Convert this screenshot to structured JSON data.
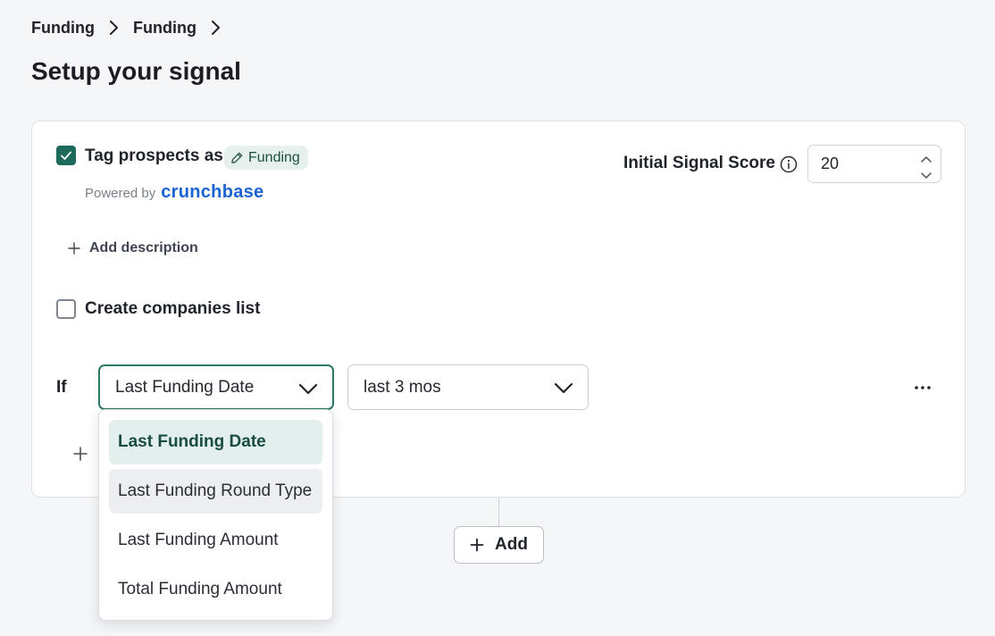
{
  "breadcrumb": [
    "Funding",
    "Funding"
  ],
  "page_title": "Setup your signal",
  "card": {
    "tag_checked": true,
    "tag_label": "Tag prospects as",
    "tag_chip": "Funding",
    "powered_by": "Powered by",
    "provider": "crunchbase",
    "add_description": "Add description",
    "create_list_checked": false,
    "create_list_label": "Create companies list",
    "score_label": "Initial Signal Score",
    "score_value": "20",
    "if_label": "If",
    "field_select": "Last Funding Date",
    "range_select": "last 3 mos"
  },
  "dropdown": {
    "options": [
      "Last Funding Date",
      "Last Funding Round Type",
      "Last Funding Amount",
      "Total Funding Amount"
    ],
    "selected": "Last Funding Date",
    "hovered": "Last Funding Round Type"
  },
  "add_button": "Add",
  "colors": {
    "accent": "#1d6a5b",
    "chip_bg": "#e6f1ee",
    "brand_crunchbase": "#1b63d4",
    "page_bg": "#f5f6f8"
  }
}
